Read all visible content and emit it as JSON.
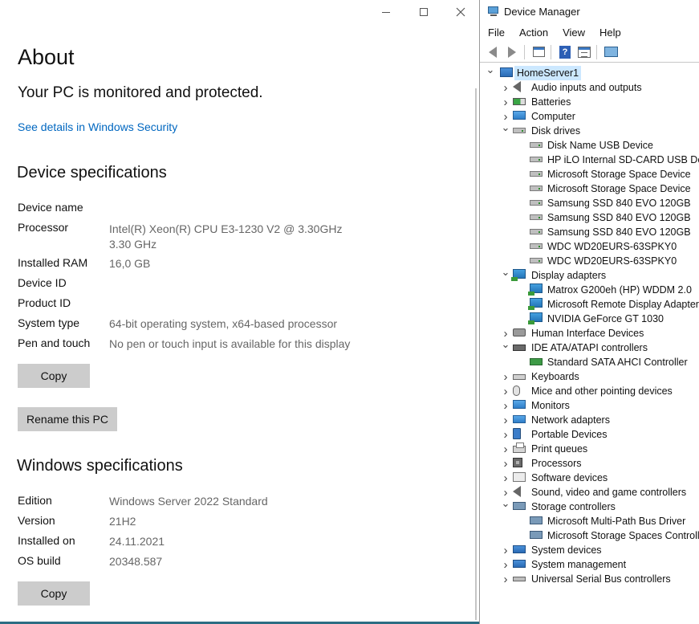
{
  "about": {
    "title": "About",
    "protection_status": "Your PC is monitored and protected.",
    "security_link": "See details in Windows Security",
    "device_specs": {
      "heading": "Device specifications",
      "rows": [
        {
          "label": "Device name",
          "value": ""
        },
        {
          "label": "Processor",
          "value": "Intel(R) Xeon(R) CPU E3-1230 V2 @ 3.30GHz   3.30 GHz"
        },
        {
          "label": "Installed RAM",
          "value": "16,0 GB"
        },
        {
          "label": "Device ID",
          "value": ""
        },
        {
          "label": "Product ID",
          "value": ""
        },
        {
          "label": "System type",
          "value": "64-bit operating system, x64-based processor"
        },
        {
          "label": "Pen and touch",
          "value": "No pen or touch input is available for this display"
        }
      ],
      "copy_label": "Copy",
      "rename_label": "Rename this PC"
    },
    "windows_specs": {
      "heading": "Windows specifications",
      "rows": [
        {
          "label": "Edition",
          "value": "Windows Server 2022 Standard"
        },
        {
          "label": "Version",
          "value": "21H2"
        },
        {
          "label": "Installed on",
          "value": "24.11.2021"
        },
        {
          "label": "OS build",
          "value": "20348.587"
        }
      ],
      "copy_label": "Copy"
    },
    "colors": {
      "link": "#0067c0",
      "button_bg": "#cccccc"
    }
  },
  "device_manager": {
    "title": "Device Manager",
    "menu": [
      "File",
      "Action",
      "View",
      "Help"
    ],
    "toolbar_icons": [
      "back-icon",
      "forward-icon",
      "properties-icon",
      "help-icon",
      "view-icon",
      "scan-hardware-icon"
    ],
    "tree": [
      {
        "label": "HomeServer1",
        "icon": "computer",
        "depth": 0,
        "state": "expanded",
        "selected": true
      },
      {
        "label": "Audio inputs and outputs",
        "icon": "sound",
        "depth": 1,
        "state": "collapsed"
      },
      {
        "label": "Batteries",
        "icon": "battery",
        "depth": 1,
        "state": "collapsed"
      },
      {
        "label": "Computer",
        "icon": "monitor",
        "depth": 1,
        "state": "collapsed"
      },
      {
        "label": "Disk drives",
        "icon": "disk",
        "depth": 1,
        "state": "expanded"
      },
      {
        "label": "Disk Name USB Device",
        "icon": "disk",
        "depth": 2
      },
      {
        "label": "HP iLO Internal SD-CARD USB Device",
        "icon": "disk",
        "depth": 2
      },
      {
        "label": "Microsoft Storage Space Device",
        "icon": "disk",
        "depth": 2
      },
      {
        "label": "Microsoft Storage Space Device",
        "icon": "disk",
        "depth": 2
      },
      {
        "label": "Samsung SSD 840 EVO 120GB",
        "icon": "disk",
        "depth": 2
      },
      {
        "label": "Samsung SSD 840 EVO 120GB",
        "icon": "disk",
        "depth": 2
      },
      {
        "label": "Samsung SSD 840 EVO 120GB",
        "icon": "disk",
        "depth": 2
      },
      {
        "label": "WDC WD20EURS-63SPKY0",
        "icon": "disk",
        "depth": 2
      },
      {
        "label": "WDC WD20EURS-63SPKY0",
        "icon": "disk",
        "depth": 2
      },
      {
        "label": "Display adapters",
        "icon": "display",
        "depth": 1,
        "state": "expanded"
      },
      {
        "label": "Matrox G200eh (HP) WDDM 2.0",
        "icon": "display",
        "depth": 2
      },
      {
        "label": "Microsoft Remote Display Adapter",
        "icon": "display",
        "depth": 2
      },
      {
        "label": "NVIDIA GeForce GT 1030",
        "icon": "display",
        "depth": 2
      },
      {
        "label": "Human Interface Devices",
        "icon": "hid",
        "depth": 1,
        "state": "collapsed"
      },
      {
        "label": "IDE ATA/ATAPI controllers",
        "icon": "ide",
        "depth": 1,
        "state": "expanded"
      },
      {
        "label": "Standard SATA AHCI Controller",
        "icon": "ctl",
        "depth": 2
      },
      {
        "label": "Keyboards",
        "icon": "kbd",
        "depth": 1,
        "state": "collapsed"
      },
      {
        "label": "Mice and other pointing devices",
        "icon": "mouse",
        "depth": 1,
        "state": "collapsed"
      },
      {
        "label": "Monitors",
        "icon": "monitor",
        "depth": 1,
        "state": "collapsed"
      },
      {
        "label": "Network adapters",
        "icon": "net",
        "depth": 1,
        "state": "collapsed"
      },
      {
        "label": "Portable Devices",
        "icon": "portable",
        "depth": 1,
        "state": "collapsed"
      },
      {
        "label": "Print queues",
        "icon": "print",
        "depth": 1,
        "state": "collapsed"
      },
      {
        "label": "Processors",
        "icon": "cpu",
        "depth": 1,
        "state": "collapsed"
      },
      {
        "label": "Software devices",
        "icon": "soft",
        "depth": 1,
        "state": "collapsed"
      },
      {
        "label": "Sound, video and game controllers",
        "icon": "sound",
        "depth": 1,
        "state": "collapsed"
      },
      {
        "label": "Storage controllers",
        "icon": "storage",
        "depth": 1,
        "state": "expanded"
      },
      {
        "label": "Microsoft Multi-Path Bus Driver",
        "icon": "storage",
        "depth": 2
      },
      {
        "label": "Microsoft Storage Spaces Controller",
        "icon": "storage",
        "depth": 2
      },
      {
        "label": "System devices",
        "icon": "sys",
        "depth": 1,
        "state": "collapsed"
      },
      {
        "label": "System management",
        "icon": "sys",
        "depth": 1,
        "state": "collapsed"
      },
      {
        "label": "Universal Serial Bus controllers",
        "icon": "usb",
        "depth": 1,
        "state": "collapsed"
      }
    ]
  }
}
